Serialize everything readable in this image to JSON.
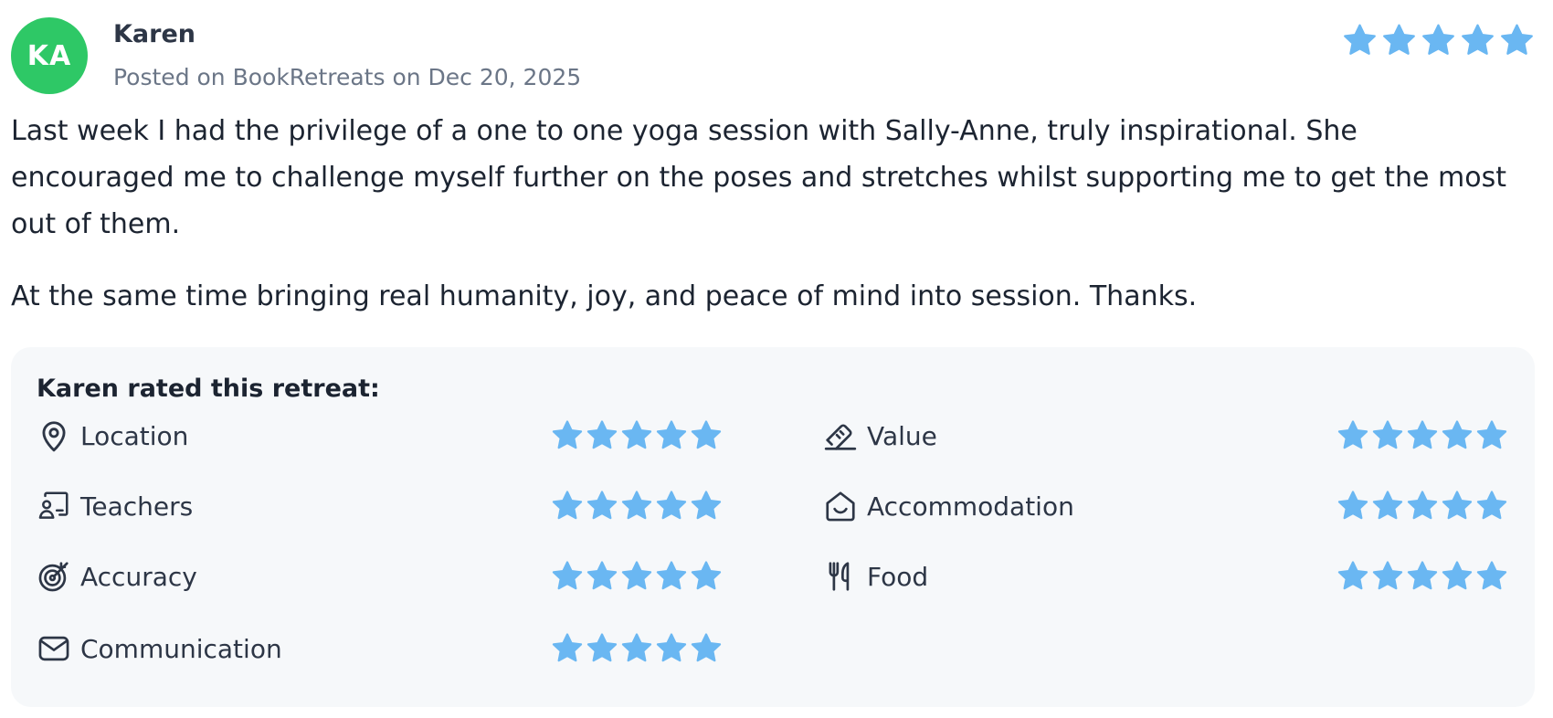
{
  "review": {
    "avatar_initials": "KA",
    "avatar_color": "#2ec866",
    "reviewer_name": "Karen",
    "posted_text": "Posted on BookRetreats on Dec 20, 2025",
    "overall_rating": 5,
    "paragraphs": [
      "Last week I had the privilege of a one to one yoga session with Sally-Anne, truly inspirational. She encouraged me to challenge myself further on the poses and stretches whilst supporting me to get the most out of them.",
      "At the same time bringing real humanity, joy, and peace of mind into session. Thanks."
    ]
  },
  "ratings_panel": {
    "title": "Karen rated this retreat:",
    "categories": [
      {
        "label": "Location",
        "icon": "location-pin-icon",
        "rating": 5
      },
      {
        "label": "Teachers",
        "icon": "teacher-icon",
        "rating": 5
      },
      {
        "label": "Accuracy",
        "icon": "target-icon",
        "rating": 5
      },
      {
        "label": "Communication",
        "icon": "envelope-icon",
        "rating": 5
      },
      {
        "label": "Value",
        "icon": "price-tag-icon",
        "rating": 5
      },
      {
        "label": "Accommodation",
        "icon": "house-icon",
        "rating": 5
      },
      {
        "label": "Food",
        "icon": "fork-knife-icon",
        "rating": 5
      }
    ]
  },
  "colors": {
    "star": "#6ab7f2",
    "panel_bg": "#f6f8fa",
    "text": "#1c2431",
    "muted": "#6b7687"
  }
}
